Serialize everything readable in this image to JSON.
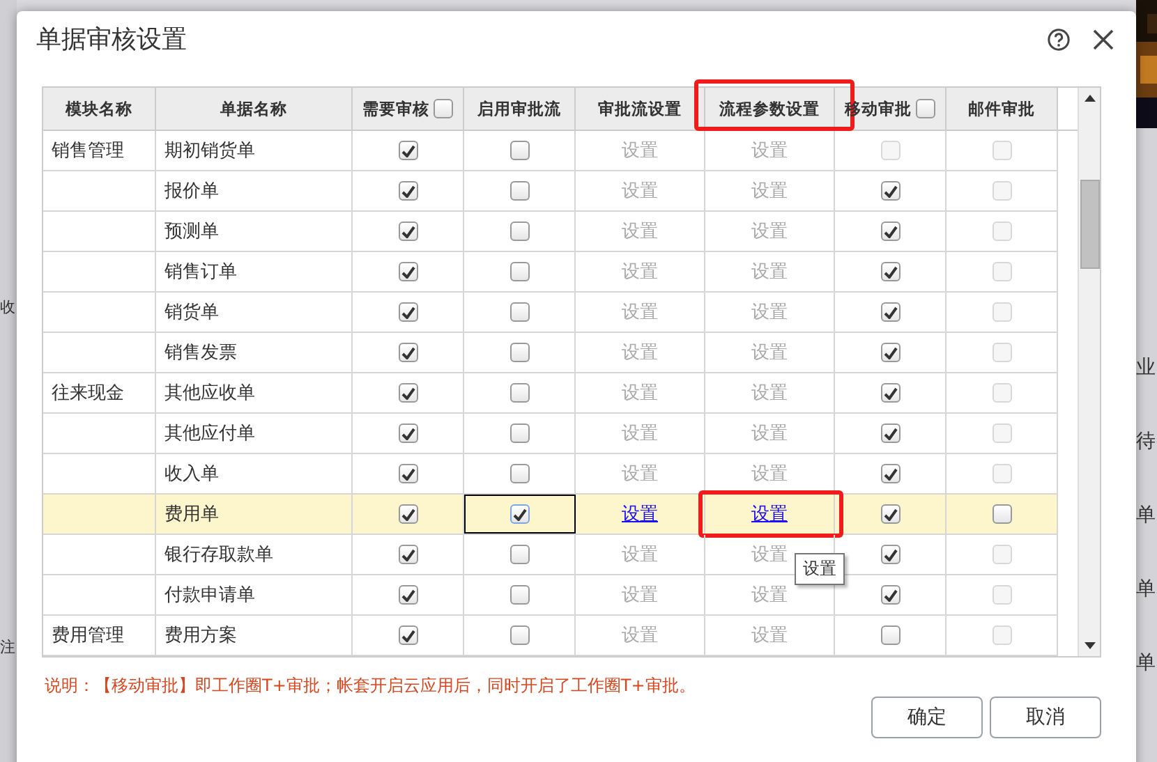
{
  "backdrop": {
    "left_texts": [
      "收",
      "注"
    ],
    "right_texts": [
      "业",
      "待",
      "单",
      "单",
      "单"
    ]
  },
  "dialog": {
    "title": "单据审核设置"
  },
  "table": {
    "columns": [
      {
        "label": "模块名称",
        "kind": "text",
        "highlighted": false
      },
      {
        "label": "单据名称",
        "kind": "text",
        "highlighted": false
      },
      {
        "label": "需要审核",
        "kind": "check",
        "checked": false,
        "highlighted": false
      },
      {
        "label": "启用审批流",
        "kind": "text",
        "highlighted": false
      },
      {
        "label": "审批流设置",
        "kind": "text",
        "highlighted": false
      },
      {
        "label": "流程参数设置",
        "kind": "text",
        "highlighted": true
      },
      {
        "label": "移动审批",
        "kind": "check",
        "checked": false,
        "highlighted": false
      },
      {
        "label": "邮件审批",
        "kind": "text",
        "highlighted": false
      }
    ],
    "rows": [
      {
        "module": "销售管理",
        "name": "期初销货单",
        "selected": false,
        "review": {
          "checked": true
        },
        "approval": {
          "checked": false,
          "focused": false
        },
        "flow_setting": {
          "label": "设置",
          "enabled": false
        },
        "param_setting": {
          "label": "设置",
          "enabled": false,
          "highlighted": false
        },
        "mobile": {
          "checked": false,
          "disabled": true
        },
        "email": {
          "checked": false,
          "disabled": true
        }
      },
      {
        "name": "报价单",
        "selected": false,
        "review": {
          "checked": true
        },
        "approval": {
          "checked": false,
          "focused": false
        },
        "flow_setting": {
          "label": "设置",
          "enabled": false
        },
        "param_setting": {
          "label": "设置",
          "enabled": false,
          "highlighted": false
        },
        "mobile": {
          "checked": true,
          "disabled": false
        },
        "email": {
          "checked": false,
          "disabled": true
        }
      },
      {
        "name": "预测单",
        "selected": false,
        "review": {
          "checked": true
        },
        "approval": {
          "checked": false,
          "focused": false
        },
        "flow_setting": {
          "label": "设置",
          "enabled": false
        },
        "param_setting": {
          "label": "设置",
          "enabled": false,
          "highlighted": false
        },
        "mobile": {
          "checked": true,
          "disabled": false
        },
        "email": {
          "checked": false,
          "disabled": true
        }
      },
      {
        "name": "销售订单",
        "selected": false,
        "review": {
          "checked": true
        },
        "approval": {
          "checked": false,
          "focused": false
        },
        "flow_setting": {
          "label": "设置",
          "enabled": false
        },
        "param_setting": {
          "label": "设置",
          "enabled": false,
          "highlighted": false
        },
        "mobile": {
          "checked": true,
          "disabled": false
        },
        "email": {
          "checked": false,
          "disabled": true
        }
      },
      {
        "name": "销货单",
        "selected": false,
        "review": {
          "checked": true
        },
        "approval": {
          "checked": false,
          "focused": false
        },
        "flow_setting": {
          "label": "设置",
          "enabled": false
        },
        "param_setting": {
          "label": "设置",
          "enabled": false,
          "highlighted": false
        },
        "mobile": {
          "checked": true,
          "disabled": false
        },
        "email": {
          "checked": false,
          "disabled": true
        }
      },
      {
        "name": "销售发票",
        "selected": false,
        "review": {
          "checked": true
        },
        "approval": {
          "checked": false,
          "focused": false
        },
        "flow_setting": {
          "label": "设置",
          "enabled": false
        },
        "param_setting": {
          "label": "设置",
          "enabled": false,
          "highlighted": false
        },
        "mobile": {
          "checked": true,
          "disabled": false
        },
        "email": {
          "checked": false,
          "disabled": true
        }
      },
      {
        "module": "往来现金",
        "name": "其他应收单",
        "selected": false,
        "review": {
          "checked": true
        },
        "approval": {
          "checked": false,
          "focused": false
        },
        "flow_setting": {
          "label": "设置",
          "enabled": false
        },
        "param_setting": {
          "label": "设置",
          "enabled": false,
          "highlighted": false
        },
        "mobile": {
          "checked": true,
          "disabled": false
        },
        "email": {
          "checked": false,
          "disabled": true
        }
      },
      {
        "name": "其他应付单",
        "selected": false,
        "review": {
          "checked": true
        },
        "approval": {
          "checked": false,
          "focused": false
        },
        "flow_setting": {
          "label": "设置",
          "enabled": false
        },
        "param_setting": {
          "label": "设置",
          "enabled": false,
          "highlighted": false
        },
        "mobile": {
          "checked": true,
          "disabled": false
        },
        "email": {
          "checked": false,
          "disabled": true
        }
      },
      {
        "name": "收入单",
        "selected": false,
        "review": {
          "checked": true
        },
        "approval": {
          "checked": false,
          "focused": false
        },
        "flow_setting": {
          "label": "设置",
          "enabled": false
        },
        "param_setting": {
          "label": "设置",
          "enabled": false,
          "highlighted": false
        },
        "mobile": {
          "checked": true,
          "disabled": false
        },
        "email": {
          "checked": false,
          "disabled": true
        }
      },
      {
        "name": "费用单",
        "selected": true,
        "review": {
          "checked": true
        },
        "approval": {
          "checked": true,
          "focused": true
        },
        "flow_setting": {
          "label": "设置",
          "enabled": true
        },
        "param_setting": {
          "label": "设置",
          "enabled": true,
          "highlighted": true,
          "tooltip": "设置"
        },
        "mobile": {
          "checked": true,
          "disabled": false
        },
        "email": {
          "checked": false,
          "disabled": false
        }
      },
      {
        "name": "银行存取款单",
        "selected": false,
        "review": {
          "checked": true
        },
        "approval": {
          "checked": false,
          "focused": false
        },
        "flow_setting": {
          "label": "设置",
          "enabled": false
        },
        "param_setting": {
          "label": "设置",
          "enabled": false,
          "highlighted": false
        },
        "mobile": {
          "checked": true,
          "disabled": false
        },
        "email": {
          "checked": false,
          "disabled": true
        }
      },
      {
        "name": "付款申请单",
        "selected": false,
        "review": {
          "checked": true
        },
        "approval": {
          "checked": false,
          "focused": false
        },
        "flow_setting": {
          "label": "设置",
          "enabled": false
        },
        "param_setting": {
          "label": "设置",
          "enabled": false,
          "highlighted": false
        },
        "mobile": {
          "checked": true,
          "disabled": false
        },
        "email": {
          "checked": false,
          "disabled": true
        }
      },
      {
        "module": "费用管理",
        "name": "费用方案",
        "selected": false,
        "review": {
          "checked": true
        },
        "approval": {
          "checked": false,
          "focused": false
        },
        "flow_setting": {
          "label": "设置",
          "enabled": false
        },
        "param_setting": {
          "label": "设置",
          "enabled": false,
          "highlighted": false
        },
        "mobile": {
          "checked": false,
          "disabled": false
        },
        "email": {
          "checked": false,
          "disabled": true
        }
      }
    ]
  },
  "note": "说明：【移动审批】即工作圈T+审批；帐套开启云应用后，同时开启了工作圈T+审批。",
  "buttons": [
    "确定",
    "取消"
  ]
}
